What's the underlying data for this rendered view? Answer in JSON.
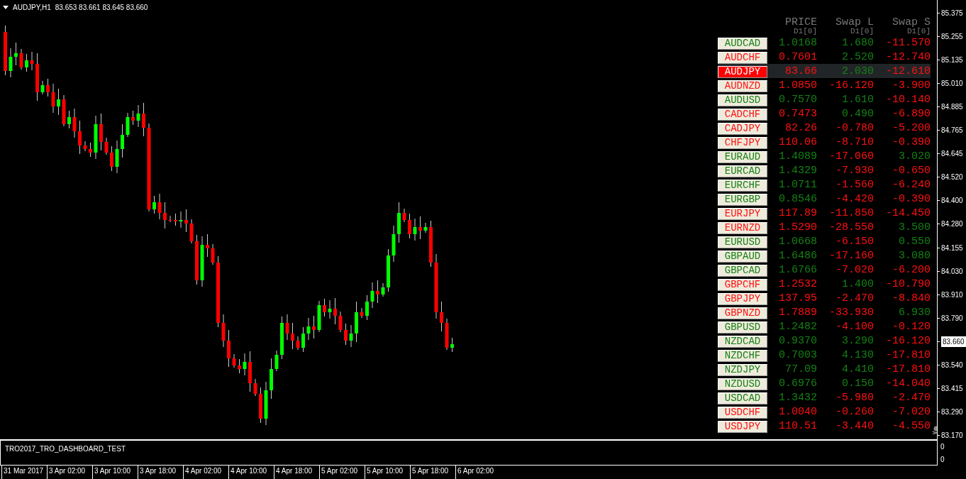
{
  "chart": {
    "symbol": "AUDJPY,H1",
    "ohlc": "83.653 83.661 83.645 83.660"
  },
  "dashboard": {
    "columns": [
      {
        "title": "PRICE",
        "sub": "D1[0]"
      },
      {
        "title": "Swap L",
        "sub": "D1[0]"
      },
      {
        "title": "Swap S",
        "sub": "D1[0]"
      }
    ],
    "rows": [
      {
        "symbol": "AUDCAD",
        "up": true,
        "selected": false,
        "price": "1.0168",
        "swap_long": "1.680",
        "long_up": true,
        "swap_short": "-11.570",
        "short_up": false
      },
      {
        "symbol": "AUDCHF",
        "up": false,
        "selected": false,
        "price": "0.7601",
        "swap_long": "2.520",
        "long_up": true,
        "swap_short": "-12.740",
        "short_up": false
      },
      {
        "symbol": "AUDJPY",
        "up": false,
        "selected": true,
        "price": "83.66",
        "swap_long": "2.030",
        "long_up": true,
        "swap_short": "-12.610",
        "short_up": false
      },
      {
        "symbol": "AUDNZD",
        "up": false,
        "selected": false,
        "price": "1.0850",
        "swap_long": "-16.120",
        "long_up": false,
        "swap_short": "-3.900",
        "short_up": false
      },
      {
        "symbol": "AUDUSD",
        "up": true,
        "selected": false,
        "price": "0.7570",
        "swap_long": "1.610",
        "long_up": true,
        "swap_short": "-10.140",
        "short_up": false
      },
      {
        "symbol": "CADCHF",
        "up": false,
        "selected": false,
        "price": "0.7473",
        "swap_long": "0.490",
        "long_up": true,
        "swap_short": "-6.890",
        "short_up": false
      },
      {
        "symbol": "CADJPY",
        "up": false,
        "selected": false,
        "price": "82.26",
        "swap_long": "-0.780",
        "long_up": false,
        "swap_short": "-5.200",
        "short_up": false
      },
      {
        "symbol": "CHFJPY",
        "up": false,
        "selected": false,
        "price": "110.06",
        "swap_long": "-8.710",
        "long_up": false,
        "swap_short": "-0.390",
        "short_up": false
      },
      {
        "symbol": "EURAUD",
        "up": true,
        "selected": false,
        "price": "1.4089",
        "swap_long": "-17.060",
        "long_up": false,
        "swap_short": "3.020",
        "short_up": true
      },
      {
        "symbol": "EURCAD",
        "up": true,
        "selected": false,
        "price": "1.4329",
        "swap_long": "-7.930",
        "long_up": false,
        "swap_short": "-0.650",
        "short_up": false
      },
      {
        "symbol": "EURCHF",
        "up": true,
        "selected": false,
        "price": "1.0711",
        "swap_long": "-1.560",
        "long_up": false,
        "swap_short": "-6.240",
        "short_up": false
      },
      {
        "symbol": "EURGBP",
        "up": true,
        "selected": false,
        "price": "0.8546",
        "swap_long": "-4.420",
        "long_up": false,
        "swap_short": "-0.390",
        "short_up": false
      },
      {
        "symbol": "EURJPY",
        "up": false,
        "selected": false,
        "price": "117.89",
        "swap_long": "-11.850",
        "long_up": false,
        "swap_short": "-14.450",
        "short_up": false
      },
      {
        "symbol": "EURNZD",
        "up": false,
        "selected": false,
        "price": "1.5290",
        "swap_long": "-28.550",
        "long_up": false,
        "swap_short": "3.500",
        "short_up": true
      },
      {
        "symbol": "EURUSD",
        "up": true,
        "selected": false,
        "price": "1.0668",
        "swap_long": "-6.150",
        "long_up": false,
        "swap_short": "0.550",
        "short_up": true
      },
      {
        "symbol": "GBPAUD",
        "up": true,
        "selected": false,
        "price": "1.6486",
        "swap_long": "-17.160",
        "long_up": false,
        "swap_short": "3.080",
        "short_up": true
      },
      {
        "symbol": "GBPCAD",
        "up": true,
        "selected": false,
        "price": "1.6766",
        "swap_long": "-7.020",
        "long_up": false,
        "swap_short": "-6.200",
        "short_up": false
      },
      {
        "symbol": "GBPCHF",
        "up": false,
        "selected": false,
        "price": "1.2532",
        "swap_long": "1.400",
        "long_up": true,
        "swap_short": "-10.790",
        "short_up": false
      },
      {
        "symbol": "GBPJPY",
        "up": false,
        "selected": false,
        "price": "137.95",
        "swap_long": "-2.470",
        "long_up": false,
        "swap_short": "-8.840",
        "short_up": false
      },
      {
        "symbol": "GBPNZD",
        "up": false,
        "selected": false,
        "price": "1.7889",
        "swap_long": "-33.930",
        "long_up": false,
        "swap_short": "6.930",
        "short_up": true
      },
      {
        "symbol": "GBPUSD",
        "up": true,
        "selected": false,
        "price": "1.2482",
        "swap_long": "-4.100",
        "long_up": false,
        "swap_short": "-0.120",
        "short_up": false
      },
      {
        "symbol": "NZDCAD",
        "up": true,
        "selected": false,
        "price": "0.9370",
        "swap_long": "3.290",
        "long_up": true,
        "swap_short": "-16.120",
        "short_up": false
      },
      {
        "symbol": "NZDCHF",
        "up": true,
        "selected": false,
        "price": "0.7003",
        "swap_long": "4.130",
        "long_up": true,
        "swap_short": "-17.810",
        "short_up": false
      },
      {
        "symbol": "NZDJPY",
        "up": true,
        "selected": false,
        "price": "77.09",
        "swap_long": "4.410",
        "long_up": true,
        "swap_short": "-17.810",
        "short_up": false
      },
      {
        "symbol": "NZDUSD",
        "up": true,
        "selected": false,
        "price": "0.6976",
        "swap_long": "0.150",
        "long_up": true,
        "swap_short": "-14.040",
        "short_up": false
      },
      {
        "symbol": "USDCAD",
        "up": true,
        "selected": false,
        "price": "1.3432",
        "swap_long": "-5.980",
        "long_up": false,
        "swap_short": "-2.470",
        "short_up": false
      },
      {
        "symbol": "USDCHF",
        "up": false,
        "selected": false,
        "price": "1.0040",
        "swap_long": "-0.260",
        "long_up": false,
        "swap_short": "-7.020",
        "short_up": false
      },
      {
        "symbol": "USDJPY",
        "up": false,
        "selected": false,
        "price": "110.51",
        "swap_long": "-3.440",
        "long_up": false,
        "swap_short": "-4.550",
        "short_up": false
      }
    ]
  },
  "price_axis": [
    {
      "label": "85.375",
      "current": false
    },
    {
      "label": "85.255",
      "current": false
    },
    {
      "label": "85.135",
      "current": false
    },
    {
      "label": "85.010",
      "current": false
    },
    {
      "label": "84.885",
      "current": false
    },
    {
      "label": "84.765",
      "current": false
    },
    {
      "label": "84.645",
      "current": false
    },
    {
      "label": "84.520",
      "current": false
    },
    {
      "label": "84.400",
      "current": false
    },
    {
      "label": "84.280",
      "current": false
    },
    {
      "label": "84.155",
      "current": false
    },
    {
      "label": "84.030",
      "current": false
    },
    {
      "label": "83.910",
      "current": false
    },
    {
      "label": "83.790",
      "current": false
    },
    {
      "label": "83.660",
      "current": true
    },
    {
      "label": "83.540",
      "current": false
    },
    {
      "label": "83.415",
      "current": false
    },
    {
      "label": "83.290",
      "current": false
    },
    {
      "label": "83.170",
      "current": false
    }
  ],
  "indicator": {
    "name": "TRO2017_TRO_DASHBOARD_TEST",
    "axis": [
      "0",
      "0"
    ]
  },
  "time_axis": [
    "31 Mar 2017",
    "3 Apr 02:00",
    "3 Apr 10:00",
    "3 Apr 18:00",
    "4 Apr 02:00",
    "4 Apr 10:00",
    "4 Apr 18:00",
    "5 Apr 02:00",
    "5 Apr 10:00",
    "5 Apr 18:00",
    "6 Apr 02:00"
  ]
}
